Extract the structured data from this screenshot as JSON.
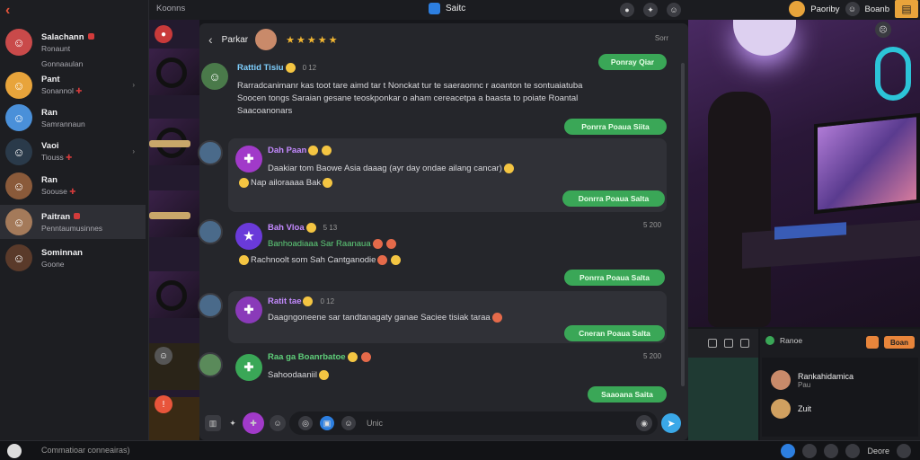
{
  "topbar": {
    "left_label": "Koonns",
    "app_title": "Saitc",
    "right_name": "Paoriby",
    "right_status": "Boanb"
  },
  "sidebar": {
    "contacts": [
      {
        "name": "Salachann",
        "sub": "Ronaunt",
        "color": "#c94a4a"
      },
      {
        "name": "Gonnaaulan",
        "sub": "",
        "color": "#d0a060"
      },
      {
        "name": "Pant",
        "sub": "Sonannol",
        "color": "#e8a43b"
      },
      {
        "name": "Ran",
        "sub": "Samrannaun",
        "color": "#4a90d9"
      },
      {
        "name": "Vaoi",
        "sub": "Tiouss",
        "color": "#2a3a4a"
      },
      {
        "name": "Ran",
        "sub": "Soouse",
        "color": "#8a5a3a"
      },
      {
        "name": "Paitran",
        "sub": "Penntaumusinnes",
        "color": "#a47a5a"
      },
      {
        "name": "Sominnan",
        "sub": "Goone",
        "color": "#5a3a2a"
      }
    ]
  },
  "chat": {
    "title": "Parkar",
    "stars": "★★★★★",
    "head_meta": "Sorr",
    "messages": [
      {
        "user": "Rattid Tisiu",
        "meta": "0 12",
        "lines": [
          "Rarradcanimanr kas toot tare aimd tar t Nonckat tur te saeraonnc r aoanton te sontuaiatuba",
          "Soocen tongs Saraian gesane teoskponkar o aham cereacetpa a baasta to poiate Roantal",
          "Saacoanonars"
        ],
        "button": "Ponray Qiar"
      },
      {
        "user": "Dah Paan",
        "meta": "",
        "lines": [
          "Daakiar tom Baowe  Asia daaag (ayr day ondae ailang cancar)",
          "Nap ailoraaaa  Bak"
        ],
        "button": "Donrra Poaua Salta",
        "button_top": "Ponrra Poaua Siita"
      },
      {
        "user": "Bah Vloa",
        "meta": "5 13",
        "lines": [
          "Banhoadiaaa Sar Raanaua",
          "Rachnoolt som  Sah Cantganodie"
        ],
        "timestamp": "5 200",
        "button": "Ponrra Poaua Salta"
      },
      {
        "user": "Ratit tae",
        "meta": "0 12",
        "lines": [
          "Daagngoneene sar tandtanagaty ganae Saciee tisiak taraa"
        ],
        "button": "Cneran Poaua Salta"
      },
      {
        "user": "Raa ga Boanrbatoe",
        "meta": "",
        "lines": [
          "Sahoodaaniil"
        ],
        "timestamp": "5 200",
        "button": "Saaoana Saita"
      }
    ],
    "compose_placeholder": "Unic"
  },
  "panel_b": {
    "header": "Ranoe",
    "button": "Boan",
    "users": [
      {
        "name": "Rankahidamica",
        "sub": "Pau"
      },
      {
        "name": "Zuit",
        "sub": ""
      }
    ]
  },
  "bottombar": {
    "input_placeholder": "Commatioar conneairas)",
    "right_label": "Deore"
  }
}
